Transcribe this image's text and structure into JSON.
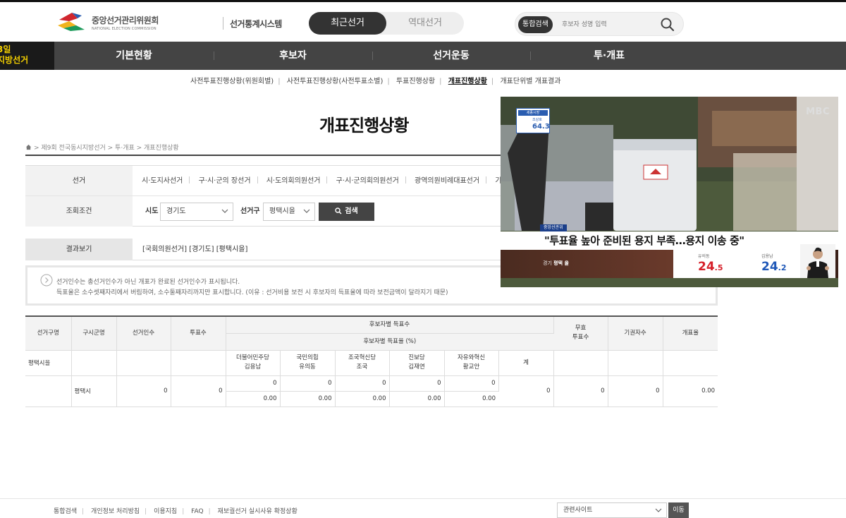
{
  "header": {
    "org_name_ko": "중앙선거관리위원회",
    "org_name_en": "NATIONAL ELECTION COMMISSION",
    "system_name": "선거통계시스템",
    "mode_active": "최근선거",
    "mode_inactive": "역대선거",
    "search_tag": "통합검색",
    "search_placeholder": "후보자 성명 입력"
  },
  "nav": {
    "badge_line1": "3일",
    "badge_line2": "지방선거",
    "items": [
      "기본현황",
      "후보자",
      "선거운동",
      "투·개표"
    ]
  },
  "subnav": {
    "items": [
      "사전투표진행상황(위원회별)",
      "사전투표진행상황(사전투표소별)",
      "투표진행상황",
      "개표진행상황",
      "개표단위별 개표결과"
    ],
    "active_index": 3
  },
  "page": {
    "title": "개표진행상황",
    "breadcrumb": "> 제9회 전국동시지방선거 > 투·개표 > 개표진행상황"
  },
  "filter": {
    "election_label": "선거",
    "elections": [
      "시·도지사선거",
      "구·시·군의 장선거",
      "시·도의회의원선거",
      "구·시·군의회의원선거",
      "광역의원비례대표선거",
      "기"
    ],
    "condition_label": "조회조건",
    "sido_label": "시도",
    "sido_value": "경기도",
    "district_label": "선거구",
    "district_value": "평택시을",
    "search_label": "검색"
  },
  "result_view": {
    "label": "결과보기",
    "text": "[국회의원선거] [경기도] [평택시을]"
  },
  "notice": {
    "line1": "선거인수는 총선거인수가 아닌 개표가 완료된 선거인수가 표시됩니다.",
    "line2": "득표율은 소수셋째자리에서 버림하여, 소수둘째자리까지만 표시합니다. (이유 : 선거비용 보전 시 후보자의 득표율에 따라 보전금액이 달라지기 때문)"
  },
  "table": {
    "headers": {
      "district": "선거구명",
      "gusigun": "구시군명",
      "electors": "선거인수",
      "voters": "투표수",
      "candidate_votes": "후보자별 득표수",
      "candidate_rate": "후보자별 득표율 (%)",
      "invalid": "무효\n투표수",
      "abstain": "기권자수",
      "count_rate": "개표율"
    },
    "candidates": [
      {
        "party": "더불어민주당",
        "name": "김용남"
      },
      {
        "party": "국민의힘",
        "name": "유의동"
      },
      {
        "party": "조국혁신당",
        "name": "조국"
      },
      {
        "party": "진보당",
        "name": "김재연"
      },
      {
        "party": "자유와혁신",
        "name": "황교안"
      }
    ],
    "total_label": "계",
    "district_name": "평택시을",
    "row": {
      "gusigun": "평택시",
      "electors": "0",
      "voters": "0",
      "votes": [
        "0",
        "0",
        "0",
        "0",
        "0"
      ],
      "total": "0",
      "invalid": "0",
      "abstain": "0",
      "count_rate": "0.00",
      "rates": [
        "0.00",
        "0.00",
        "0.00",
        "0.00",
        "0.00"
      ]
    }
  },
  "video": {
    "badge_title": "세종시장",
    "badge_name": "조상호",
    "badge_value": "64.3",
    "channel": "MBC",
    "caption_tag": "중앙선관위",
    "caption": "\"투표율 높아 준비된 용지 부족…용지 이송 중\"",
    "region": "경기",
    "region_bold": "평택 을",
    "cand1_name": "유의동",
    "cand1_int": "24",
    "cand1_dec": ".5",
    "cand2_name": "김용남",
    "cand2_int": "24",
    "cand2_dec": ".2",
    "colors": {
      "cand1": "#d6202a",
      "cand2": "#1f58b8"
    }
  },
  "footer": {
    "links": [
      "통합검색",
      "개인정보 처리방침",
      "이용지침",
      "FAQ",
      "재보궐선거 실시사유 확정상황"
    ],
    "related_label": "관련사이트",
    "go_label": "이동"
  }
}
